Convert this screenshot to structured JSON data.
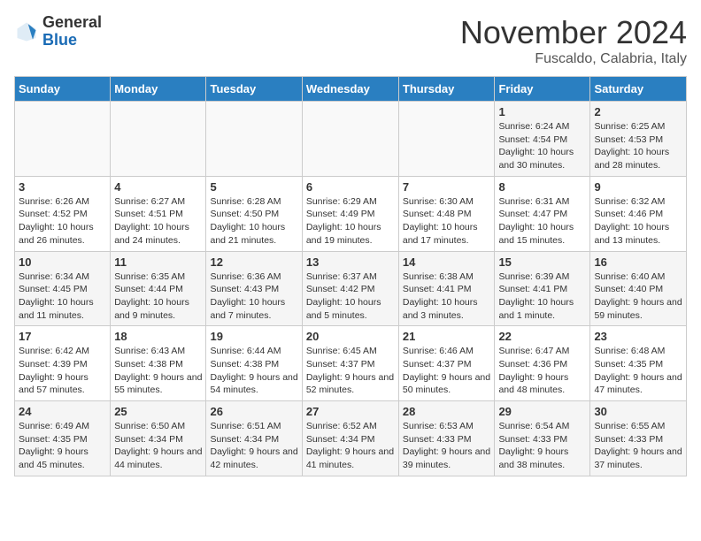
{
  "header": {
    "logo_general": "General",
    "logo_blue": "Blue",
    "month_title": "November 2024",
    "subtitle": "Fuscaldo, Calabria, Italy"
  },
  "weekdays": [
    "Sunday",
    "Monday",
    "Tuesday",
    "Wednesday",
    "Thursday",
    "Friday",
    "Saturday"
  ],
  "weeks": [
    [
      {
        "day": "",
        "info": ""
      },
      {
        "day": "",
        "info": ""
      },
      {
        "day": "",
        "info": ""
      },
      {
        "day": "",
        "info": ""
      },
      {
        "day": "",
        "info": ""
      },
      {
        "day": "1",
        "info": "Sunrise: 6:24 AM\nSunset: 4:54 PM\nDaylight: 10 hours and 30 minutes."
      },
      {
        "day": "2",
        "info": "Sunrise: 6:25 AM\nSunset: 4:53 PM\nDaylight: 10 hours and 28 minutes."
      }
    ],
    [
      {
        "day": "3",
        "info": "Sunrise: 6:26 AM\nSunset: 4:52 PM\nDaylight: 10 hours and 26 minutes."
      },
      {
        "day": "4",
        "info": "Sunrise: 6:27 AM\nSunset: 4:51 PM\nDaylight: 10 hours and 24 minutes."
      },
      {
        "day": "5",
        "info": "Sunrise: 6:28 AM\nSunset: 4:50 PM\nDaylight: 10 hours and 21 minutes."
      },
      {
        "day": "6",
        "info": "Sunrise: 6:29 AM\nSunset: 4:49 PM\nDaylight: 10 hours and 19 minutes."
      },
      {
        "day": "7",
        "info": "Sunrise: 6:30 AM\nSunset: 4:48 PM\nDaylight: 10 hours and 17 minutes."
      },
      {
        "day": "8",
        "info": "Sunrise: 6:31 AM\nSunset: 4:47 PM\nDaylight: 10 hours and 15 minutes."
      },
      {
        "day": "9",
        "info": "Sunrise: 6:32 AM\nSunset: 4:46 PM\nDaylight: 10 hours and 13 minutes."
      }
    ],
    [
      {
        "day": "10",
        "info": "Sunrise: 6:34 AM\nSunset: 4:45 PM\nDaylight: 10 hours and 11 minutes."
      },
      {
        "day": "11",
        "info": "Sunrise: 6:35 AM\nSunset: 4:44 PM\nDaylight: 10 hours and 9 minutes."
      },
      {
        "day": "12",
        "info": "Sunrise: 6:36 AM\nSunset: 4:43 PM\nDaylight: 10 hours and 7 minutes."
      },
      {
        "day": "13",
        "info": "Sunrise: 6:37 AM\nSunset: 4:42 PM\nDaylight: 10 hours and 5 minutes."
      },
      {
        "day": "14",
        "info": "Sunrise: 6:38 AM\nSunset: 4:41 PM\nDaylight: 10 hours and 3 minutes."
      },
      {
        "day": "15",
        "info": "Sunrise: 6:39 AM\nSunset: 4:41 PM\nDaylight: 10 hours and 1 minute."
      },
      {
        "day": "16",
        "info": "Sunrise: 6:40 AM\nSunset: 4:40 PM\nDaylight: 9 hours and 59 minutes."
      }
    ],
    [
      {
        "day": "17",
        "info": "Sunrise: 6:42 AM\nSunset: 4:39 PM\nDaylight: 9 hours and 57 minutes."
      },
      {
        "day": "18",
        "info": "Sunrise: 6:43 AM\nSunset: 4:38 PM\nDaylight: 9 hours and 55 minutes."
      },
      {
        "day": "19",
        "info": "Sunrise: 6:44 AM\nSunset: 4:38 PM\nDaylight: 9 hours and 54 minutes."
      },
      {
        "day": "20",
        "info": "Sunrise: 6:45 AM\nSunset: 4:37 PM\nDaylight: 9 hours and 52 minutes."
      },
      {
        "day": "21",
        "info": "Sunrise: 6:46 AM\nSunset: 4:37 PM\nDaylight: 9 hours and 50 minutes."
      },
      {
        "day": "22",
        "info": "Sunrise: 6:47 AM\nSunset: 4:36 PM\nDaylight: 9 hours and 48 minutes."
      },
      {
        "day": "23",
        "info": "Sunrise: 6:48 AM\nSunset: 4:35 PM\nDaylight: 9 hours and 47 minutes."
      }
    ],
    [
      {
        "day": "24",
        "info": "Sunrise: 6:49 AM\nSunset: 4:35 PM\nDaylight: 9 hours and 45 minutes."
      },
      {
        "day": "25",
        "info": "Sunrise: 6:50 AM\nSunset: 4:34 PM\nDaylight: 9 hours and 44 minutes."
      },
      {
        "day": "26",
        "info": "Sunrise: 6:51 AM\nSunset: 4:34 PM\nDaylight: 9 hours and 42 minutes."
      },
      {
        "day": "27",
        "info": "Sunrise: 6:52 AM\nSunset: 4:34 PM\nDaylight: 9 hours and 41 minutes."
      },
      {
        "day": "28",
        "info": "Sunrise: 6:53 AM\nSunset: 4:33 PM\nDaylight: 9 hours and 39 minutes."
      },
      {
        "day": "29",
        "info": "Sunrise: 6:54 AM\nSunset: 4:33 PM\nDaylight: 9 hours and 38 minutes."
      },
      {
        "day": "30",
        "info": "Sunrise: 6:55 AM\nSunset: 4:33 PM\nDaylight: 9 hours and 37 minutes."
      }
    ]
  ]
}
